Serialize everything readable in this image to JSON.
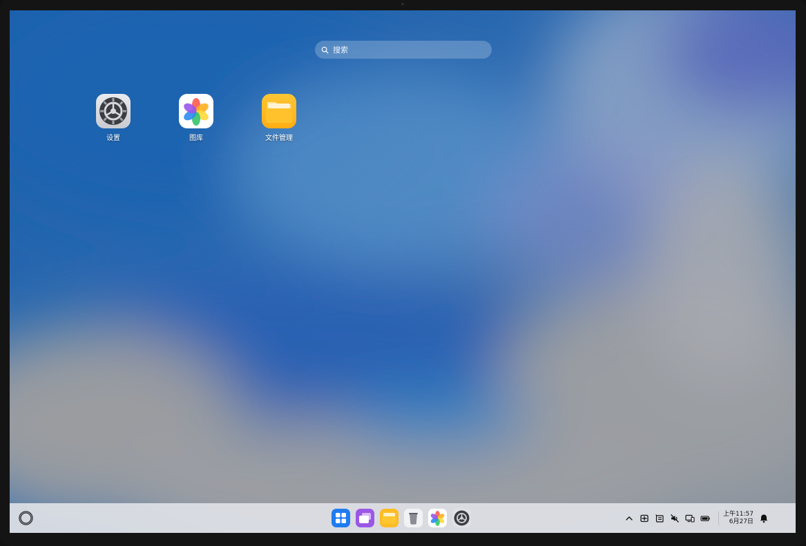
{
  "search": {
    "placeholder": "搜索"
  },
  "desktop": {
    "icons": [
      {
        "label": "设置",
        "icon": "settings-gear-icon"
      },
      {
        "label": "图库",
        "icon": "gallery-flower-icon"
      },
      {
        "label": "文件管理",
        "icon": "file-folder-icon"
      }
    ]
  },
  "taskbar": {
    "start_icon": "start-ring-icon",
    "dock": [
      {
        "icon": "app-grid-icon"
      },
      {
        "icon": "multitask-windows-icon"
      },
      {
        "icon": "file-manager-icon"
      },
      {
        "icon": "trash-icon"
      },
      {
        "icon": "gallery-icon"
      },
      {
        "icon": "settings-icon"
      }
    ],
    "tray": [
      {
        "icon": "chevron-up-icon"
      },
      {
        "icon": "input-method-icon"
      },
      {
        "icon": "clipboard-icon"
      },
      {
        "icon": "sound-muted-icon"
      },
      {
        "icon": "device-connect-icon"
      },
      {
        "icon": "battery-icon"
      }
    ],
    "clock": {
      "time": "上午11:57",
      "date": "6月27日"
    },
    "notification_icon": "bell-icon"
  },
  "colors": {
    "wallpaper_blue": "#1f5fa8",
    "taskbar_bg": "#dee0e5"
  }
}
